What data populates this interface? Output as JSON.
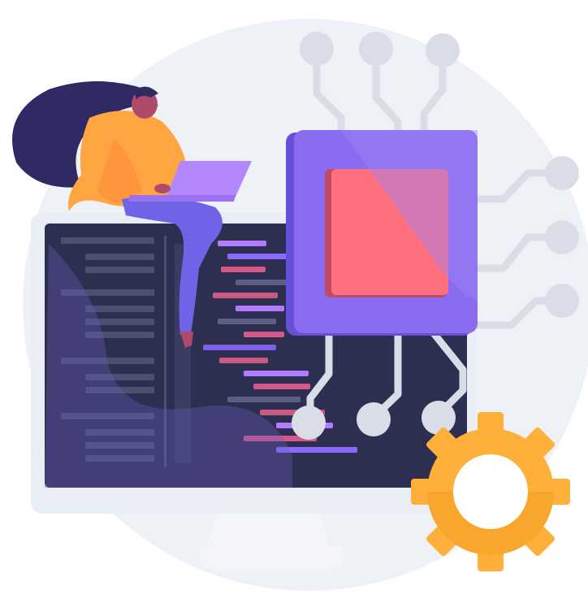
{
  "illustration": {
    "subject": "woman-with-laptop-sitting-on-monitor-with-processor-chip-and-gear",
    "colors": {
      "background_circle": "#eef1f6",
      "monitor_frame": "#e9edf4",
      "monitor_screen": "#2c2f4f",
      "stand": "#f3f5f9",
      "chip_body": "#8b6cf0",
      "chip_body_dark": "#6a4fd8",
      "chip_core": "#ff6f7e",
      "circuit": "#d8dde8",
      "gear": "#ffb03a",
      "gear_dark": "#f29d1e",
      "hair": "#2f2a63",
      "skin": "#b04a6a",
      "shirt": "#ffa642",
      "pants": "#6f63e8",
      "laptop": "#b388ff"
    },
    "icons": [
      "monitor-icon",
      "processor-chip-icon",
      "gear-icon",
      "laptop-icon",
      "person-icon"
    ]
  }
}
